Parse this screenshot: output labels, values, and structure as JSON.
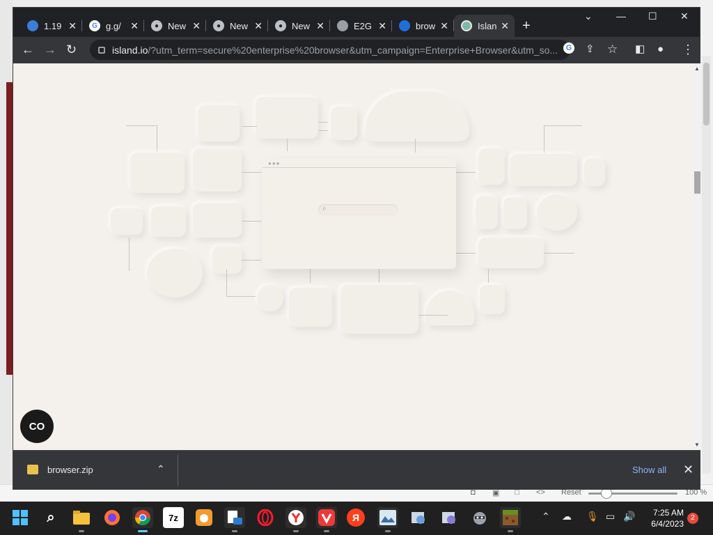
{
  "tabs": [
    {
      "title": "1.19",
      "favicon": "globe-icon"
    },
    {
      "title": "g.g/",
      "favicon": "google-icon"
    },
    {
      "title": "New",
      "favicon": "chrome-icon"
    },
    {
      "title": "New",
      "favicon": "chrome-icon"
    },
    {
      "title": "New",
      "favicon": "chrome-icon"
    },
    {
      "title": "E2G",
      "favicon": "globe-icon"
    },
    {
      "title": "brow",
      "favicon": "edge-icon"
    },
    {
      "title": "Islan",
      "favicon": "island-icon",
      "active": true
    }
  ],
  "address_bar": {
    "host": "island.io",
    "path": "/?utm_term=secure%20enterprise%20browser&utm_campaign=Enterprise+Browser&utm_so..."
  },
  "page": {
    "chat_label": "CO"
  },
  "downloads": {
    "file_name": "browser.zip",
    "show_all": "Show all"
  },
  "behind_bar": {
    "reset": "Reset",
    "zoom": "100 %"
  },
  "taskbar": {
    "time": "7:25 AM",
    "date": "6/4/2023",
    "notifications": "2",
    "apps": [
      {
        "name": "file-explorer",
        "label": ""
      },
      {
        "name": "firefox",
        "label": ""
      },
      {
        "name": "chrome",
        "label": ""
      },
      {
        "name": "7zip",
        "label": "7z"
      },
      {
        "name": "uc-browser",
        "label": ""
      },
      {
        "name": "onedrive-app",
        "label": ""
      },
      {
        "name": "opera",
        "label": ""
      },
      {
        "name": "yandex",
        "label": ""
      },
      {
        "name": "vivaldi",
        "label": ""
      },
      {
        "name": "yandex-browser",
        "label": "Я"
      },
      {
        "name": "photos",
        "label": ""
      },
      {
        "name": "app-installer-1",
        "label": ""
      },
      {
        "name": "app-installer-2",
        "label": ""
      },
      {
        "name": "raccoon",
        "label": ""
      },
      {
        "name": "minecraft",
        "label": ""
      }
    ]
  }
}
